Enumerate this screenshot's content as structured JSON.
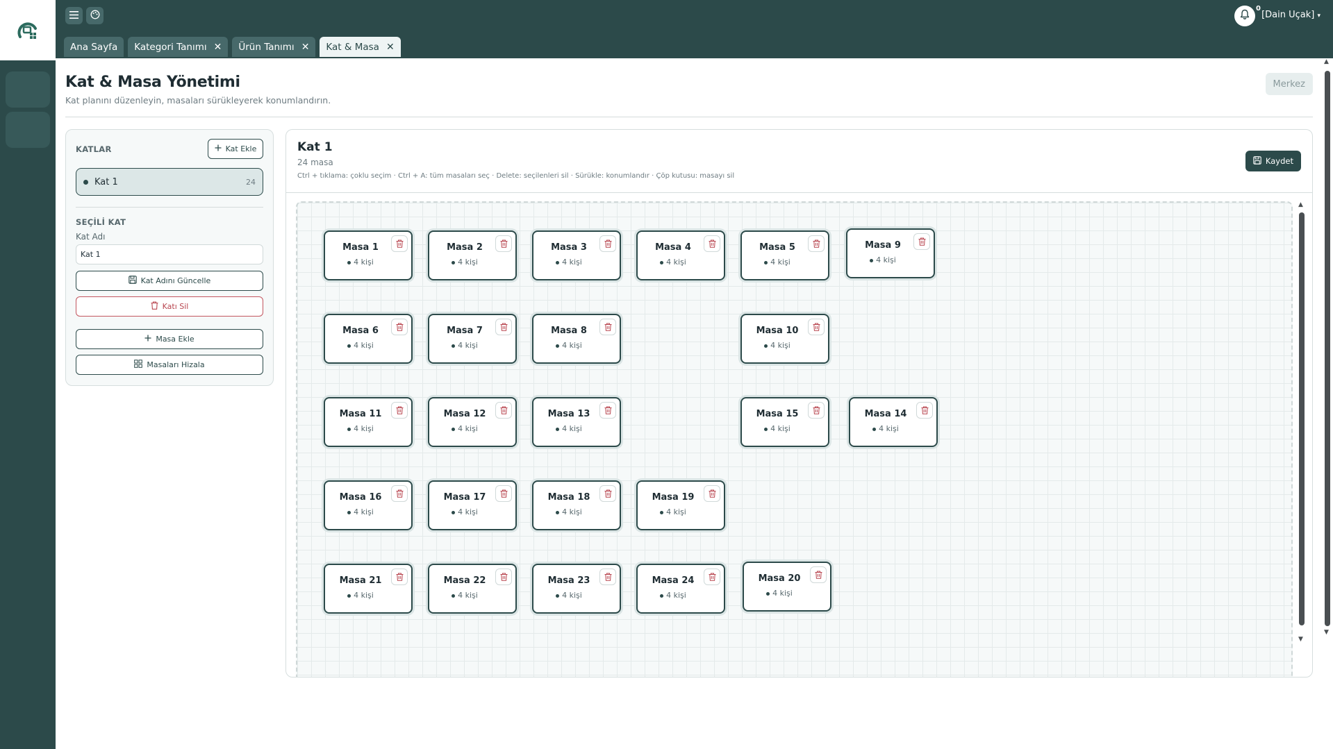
{
  "topbar": {
    "menu_icon": "hamburger-icon",
    "palette_icon": "palette-icon",
    "tabs": [
      {
        "label": "Ana Sayfa",
        "closable": false
      },
      {
        "label": "Kategori Tanımı",
        "closable": true
      },
      {
        "label": "Ürün Tanımı",
        "closable": true
      },
      {
        "label": "Kat & Masa",
        "closable": true,
        "active": true
      }
    ],
    "tab_close_glyph": "✕",
    "notification_count": "0",
    "user_label": "[Dain Uçak]",
    "user_caret": "▾"
  },
  "page": {
    "title": "Kat & Masa Yönetimi",
    "subtitle": "Kat planını düzenleyin, masaları sürükleyerek konumlandırın.",
    "branch_button": "Merkez"
  },
  "left": {
    "floors_label": "KATLAR",
    "add_floor": "Kat Ekle",
    "floors": [
      {
        "name": "Kat 1",
        "count": "24"
      }
    ],
    "selected_label": "SEÇİLİ KAT",
    "floor_name_label": "Kat Adı",
    "floor_name_value": "Kat 1",
    "update_button": "Kat Adını Güncelle",
    "delete_button": "Katı Sil",
    "add_table_button": "Masa Ekle",
    "align_button": "Masaları Hizala"
  },
  "right": {
    "title": "Kat 1",
    "count_text": "24 masa",
    "hint": "Ctrl + tıklama: çoklu seçim · Ctrl + A: tüm masaları seç · Delete: seçilenleri sil · Sürükle: konumlandır · Çöp kutusu: masayı sil",
    "save_button": "Kaydet"
  },
  "tables": [
    {
      "name": "Masa 1",
      "capacity": "4 kişi"
    },
    {
      "name": "Masa 2",
      "capacity": "4 kişi"
    },
    {
      "name": "Masa 3",
      "capacity": "4 kişi"
    },
    {
      "name": "Masa 4",
      "capacity": "4 kişi"
    },
    {
      "name": "Masa 5",
      "capacity": "4 kişi"
    },
    {
      "name": "Masa 9",
      "capacity": "4 kişi"
    },
    {
      "name": "Masa 6",
      "capacity": "4 kişi"
    },
    {
      "name": "Masa 7",
      "capacity": "4 kişi"
    },
    {
      "name": "Masa 8",
      "capacity": "4 kişi"
    },
    {
      "name": "Masa 10",
      "capacity": "4 kişi"
    },
    {
      "name": "Masa 11",
      "capacity": "4 kişi"
    },
    {
      "name": "Masa 12",
      "capacity": "4 kişi"
    },
    {
      "name": "Masa 13",
      "capacity": "4 kişi"
    },
    {
      "name": "Masa 15",
      "capacity": "4 kişi"
    },
    {
      "name": "Masa 14",
      "capacity": "4 kişi"
    },
    {
      "name": "Masa 16",
      "capacity": "4 kişi"
    },
    {
      "name": "Masa 17",
      "capacity": "4 kişi"
    },
    {
      "name": "Masa 18",
      "capacity": "4 kişi"
    },
    {
      "name": "Masa 19",
      "capacity": "4 kişi"
    },
    {
      "name": "Masa 21",
      "capacity": "4 kişi"
    },
    {
      "name": "Masa 22",
      "capacity": "4 kişi"
    },
    {
      "name": "Masa 23",
      "capacity": "4 kişi"
    },
    {
      "name": "Masa 24",
      "capacity": "4 kişi"
    },
    {
      "name": "Masa 20",
      "capacity": "4 kişi"
    }
  ],
  "colors": {
    "primary": "#2c4a4a",
    "danger": "#b8454f",
    "canvas_bg": "#f6f9f9"
  }
}
